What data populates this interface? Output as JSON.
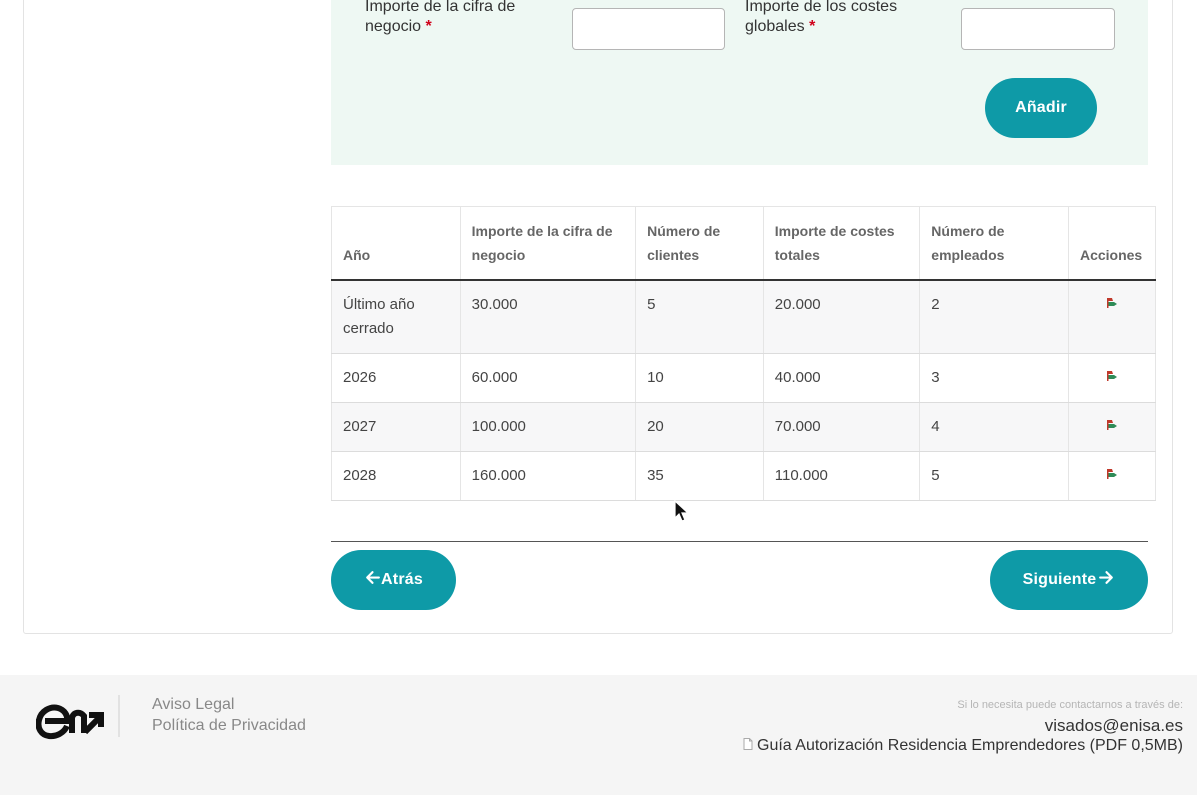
{
  "form": {
    "revenue_label": "Importe de la cifra de negocio",
    "costs_label": "Importe de los costes globales",
    "required_mark": "*",
    "revenue_value": "",
    "costs_value": "",
    "add_button": "Añadir"
  },
  "table": {
    "headers": [
      "Año",
      "Importe de la cifra de negocio",
      "Número de clientes",
      "Importe de costes totales",
      "Número de empleados",
      "Acciones"
    ],
    "rows": [
      {
        "year": "Último año cerrado",
        "revenue": "30.000",
        "clients": "5",
        "costs": "20.000",
        "employees": "2"
      },
      {
        "year": "2026",
        "revenue": "60.000",
        "clients": "10",
        "costs": "40.000",
        "employees": "3"
      },
      {
        "year": "2027",
        "revenue": "100.000",
        "clients": "20",
        "costs": "70.000",
        "employees": "4"
      },
      {
        "year": "2028",
        "revenue": "160.000",
        "clients": "35",
        "costs": "110.000",
        "employees": "5"
      }
    ],
    "action_icon": "edit-delete-icon"
  },
  "nav": {
    "back_label": "Atrás",
    "next_label": "Siguiente"
  },
  "footer": {
    "legal_link": "Aviso Legal",
    "privacy_link": "Política de Privacidad",
    "contact_hint": "Si lo necesita puede contactarnos a través de:",
    "contact_email": "visados@enisa.es",
    "guide_link": "Guía Autorización Residencia Emprendedores (PDF 0,5MB)"
  },
  "colors": {
    "accent": "#0e9aa7",
    "panel_bg": "#eef8f3",
    "required": "#d0021b"
  }
}
